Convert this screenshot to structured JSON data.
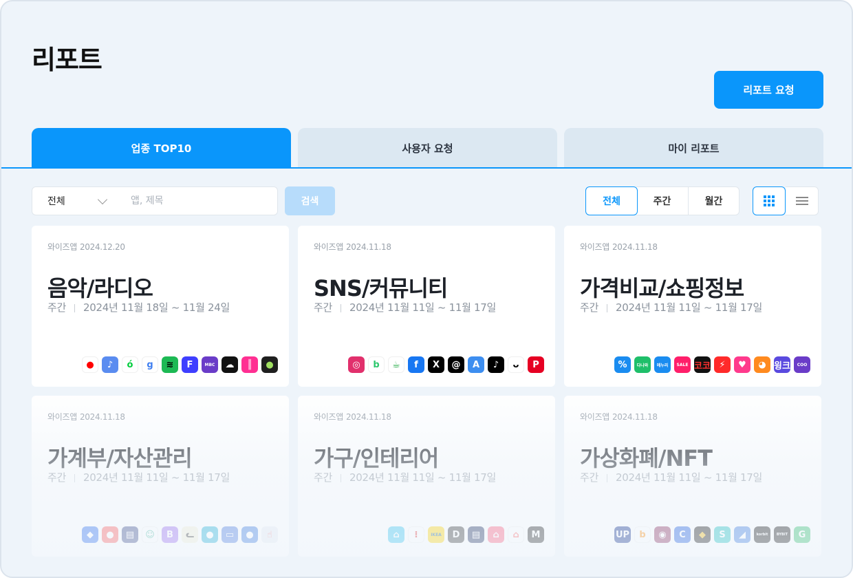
{
  "page_title": "리포트",
  "request_button": "리포트 요청",
  "tabs": [
    {
      "label": "업종 TOP10",
      "active": true
    },
    {
      "label": "사용자 요청",
      "active": false
    },
    {
      "label": "마이 리포트",
      "active": false
    }
  ],
  "filter": {
    "category_selected": "전체",
    "search_placeholder": "앱, 제목",
    "search_button": "검색",
    "periods": [
      "전체",
      "주간",
      "월간"
    ],
    "active_period": "전체",
    "view_modes": [
      "grid-icon",
      "list-icon"
    ],
    "active_view": "grid-icon"
  },
  "colors": {
    "accent": "#0a96fb",
    "tab_inactive": "#dce8f2",
    "background": "#eef4fa"
  },
  "cards": [
    {
      "source": "와이즈앱",
      "date": "2024.12.20",
      "title": "음악/라디오",
      "period_type": "주간",
      "range": "2024년 11월 18일 ~ 11월 24일",
      "icons": [
        {
          "name": "youtube-music-icon",
          "bg": "#ffffff",
          "fg": "#ff0000",
          "glyph": "●"
        },
        {
          "name": "apple-music-icon",
          "bg": "#5a8cf0",
          "fg": "#ffffff",
          "glyph": "♪"
        },
        {
          "name": "melon-icon",
          "bg": "#ffffff",
          "fg": "#00cd3c",
          "glyph": "ó"
        },
        {
          "name": "genie-icon",
          "bg": "#ffffff",
          "fg": "#3e7ef0",
          "glyph": "g"
        },
        {
          "name": "spotify-icon",
          "bg": "#1db954",
          "fg": "#000000",
          "glyph": "≋"
        },
        {
          "name": "flo-icon",
          "bg": "#3f3fff",
          "fg": "#ffffff",
          "glyph": "F"
        },
        {
          "name": "mbc-radio-icon",
          "bg": "#6a3cc8",
          "fg": "#ffffff",
          "glyph": "MBC"
        },
        {
          "name": "soundcloud-icon",
          "bg": "#111111",
          "fg": "#ffffff",
          "glyph": "☁"
        },
        {
          "name": "vibe-icon",
          "bg": "#ff2f92",
          "fg": "#ffffff",
          "glyph": "║"
        },
        {
          "name": "podbbang-icon",
          "bg": "#1f1f1f",
          "fg": "#a0e060",
          "glyph": "●"
        }
      ]
    },
    {
      "source": "와이즈앱",
      "date": "2024.11.18",
      "title": "SNS/커뮤니티",
      "period_type": "주간",
      "range": "2024년 11월 11일 ~ 11월 17일",
      "icons": [
        {
          "name": "instagram-icon",
          "bg": "#e1306c",
          "fg": "#ffffff",
          "glyph": "◎"
        },
        {
          "name": "band-icon",
          "bg": "#ffffff",
          "fg": "#2dc76d",
          "glyph": "b"
        },
        {
          "name": "kakao-story-icon",
          "bg": "#ffffff",
          "fg": "#22aa44",
          "glyph": "☕"
        },
        {
          "name": "facebook-icon",
          "bg": "#1877f2",
          "fg": "#ffffff",
          "glyph": "f"
        },
        {
          "name": "x-icon",
          "bg": "#000000",
          "fg": "#ffffff",
          "glyph": "X"
        },
        {
          "name": "threads-icon",
          "bg": "#000000",
          "fg": "#ffffff",
          "glyph": "@"
        },
        {
          "name": "alight-icon",
          "bg": "#3d8ef0",
          "fg": "#ffffff",
          "glyph": "A"
        },
        {
          "name": "tiktok-icon",
          "bg": "#000000",
          "fg": "#ffffff",
          "glyph": "♪"
        },
        {
          "name": "bunjang-smile-icon",
          "bg": "#ffffff",
          "fg": "#000000",
          "glyph": "ᴗ"
        },
        {
          "name": "pinterest-icon",
          "bg": "#e60023",
          "fg": "#ffffff",
          "glyph": "P"
        }
      ]
    },
    {
      "source": "와이즈앱",
      "date": "2024.11.18",
      "title": "가격비교/쇼핑정보",
      "period_type": "주간",
      "range": "2024년 11월 11일 ~ 11월 17일",
      "icons": [
        {
          "name": "coupon-icon",
          "bg": "#1a8cf0",
          "fg": "#ffffff",
          "glyph": "%"
        },
        {
          "name": "danawa-icon",
          "bg": "#1fbf6a",
          "fg": "#ffffff",
          "glyph": "다나와"
        },
        {
          "name": "enuri-icon",
          "bg": "#1a8cf0",
          "fg": "#ffffff",
          "glyph": "에누리"
        },
        {
          "name": "shopping-deal-icon",
          "bg": "#ff1f6a",
          "fg": "#ffffff",
          "glyph": "SALE"
        },
        {
          "name": "coco-discount-icon",
          "bg": "#111111",
          "fg": "#ff3030",
          "glyph": "코코"
        },
        {
          "name": "lightning-icon",
          "bg": "#ff2a2a",
          "fg": "#ffffff",
          "glyph": "⚡"
        },
        {
          "name": "pinky-icon",
          "bg": "#ff3a8c",
          "fg": "#ffffff",
          "glyph": "♥"
        },
        {
          "name": "shiba-icon",
          "bg": "#ff8a1f",
          "fg": "#ffffff",
          "glyph": "◕"
        },
        {
          "name": "wink-icon",
          "bg": "#5a4adf",
          "fg": "#ffffff",
          "glyph": "윙크"
        },
        {
          "name": "coo-icon",
          "bg": "#6a3cc8",
          "fg": "#ffffff",
          "glyph": "COO"
        }
      ]
    },
    {
      "source": "와이즈앱",
      "date": "2024.11.18",
      "title": "가계부/자산관리",
      "period_type": "주간",
      "range": "2024년 11월 11일 ~ 11월 17일",
      "icons": [
        {
          "name": "banksalad-icon",
          "bg": "#2a6cf0",
          "fg": "#ffffff",
          "glyph": "◆"
        },
        {
          "name": "piggy-bank-icon",
          "bg": "#ff5a5a",
          "fg": "#ffffff",
          "glyph": "●"
        },
        {
          "name": "receipt-icon",
          "bg": "#3b4a8a",
          "fg": "#ffffff",
          "glyph": "▤"
        },
        {
          "name": "smile-icon",
          "bg": "#ffffff",
          "fg": "#30b090",
          "glyph": "☺"
        },
        {
          "name": "b-ledger-icon",
          "bg": "#9b6af0",
          "fg": "#ffffff",
          "glyph": "B"
        },
        {
          "name": "cat-ledger-icon",
          "bg": "#f5f0d8",
          "fg": "#333333",
          "glyph": "ᓚ"
        },
        {
          "name": "pig-icon",
          "bg": "#1fb0d8",
          "fg": "#ffffff",
          "glyph": "●"
        },
        {
          "name": "card-icon",
          "bg": "#4a7ae0",
          "fg": "#ffffff",
          "glyph": "▭"
        },
        {
          "name": "chat-bubble-icon",
          "bg": "#3a7ae0",
          "fg": "#ffffff",
          "glyph": "●"
        },
        {
          "name": "hand-icon",
          "bg": "#e8ecf4",
          "fg": "#ff5a5a",
          "glyph": "☝"
        }
      ]
    },
    {
      "source": "와이즈앱",
      "date": "2024.11.18",
      "title": "가구/인테리어",
      "period_type": "주간",
      "range": "2024년 11월 11일 ~ 11월 17일",
      "icons": [
        {
          "name": "ohouse-icon",
          "bg": "#35c5f0",
          "fg": "#ffffff",
          "glyph": "⌂"
        },
        {
          "name": "hanssem-icon",
          "bg": "#ffffff",
          "fg": "#e02020",
          "glyph": "⁝"
        },
        {
          "name": "ikea-icon",
          "bg": "#ffd400",
          "fg": "#0058a3",
          "glyph": "IKEA"
        },
        {
          "name": "d-icon",
          "bg": "#333333",
          "fg": "#ffffff",
          "glyph": "D"
        },
        {
          "name": "magazine-icon",
          "bg": "#1a2a5a",
          "fg": "#ffffff",
          "glyph": "▤"
        },
        {
          "name": "home-icon",
          "bg": "#ff5a7a",
          "fg": "#ffffff",
          "glyph": "⌂"
        },
        {
          "name": "house-outline-icon",
          "bg": "#ffffff",
          "fg": "#ff5a5a",
          "glyph": "⌂"
        },
        {
          "name": "m-icon",
          "bg": "#222222",
          "fg": "#ffffff",
          "glyph": "M"
        }
      ]
    },
    {
      "source": "와이즈앱",
      "date": "2024.11.18",
      "title": "가상화폐/NFT",
      "period_type": "주간",
      "range": "2024년 11월 11일 ~ 11월 17일",
      "icons": [
        {
          "name": "upbit-icon",
          "bg": "#0a2a8a",
          "fg": "#ffffff",
          "glyph": "UP"
        },
        {
          "name": "bithumb-icon",
          "bg": "#ffffff",
          "fg": "#ff8a00",
          "glyph": "b"
        },
        {
          "name": "coin-icon",
          "bg": "#8a2a5a",
          "fg": "#ffffff",
          "glyph": "◉"
        },
        {
          "name": "coinone-icon",
          "bg": "#1a5adf",
          "fg": "#ffffff",
          "glyph": "C"
        },
        {
          "name": "binance-icon",
          "bg": "#111111",
          "fg": "#f0b90b",
          "glyph": "◆"
        },
        {
          "name": "s-icon",
          "bg": "#1ac0c0",
          "fg": "#ffffff",
          "glyph": "S"
        },
        {
          "name": "bird-icon",
          "bg": "#3a7ae0",
          "fg": "#ffffff",
          "glyph": "◢"
        },
        {
          "name": "korbit-icon",
          "bg": "#111111",
          "fg": "#ffffff",
          "glyph": "korbit"
        },
        {
          "name": "bybit-icon",
          "bg": "#111111",
          "fg": "#ffffff",
          "glyph": "BYBIT"
        },
        {
          "name": "g-icon",
          "bg": "#2fbf6a",
          "fg": "#ffffff",
          "glyph": "G"
        }
      ]
    }
  ]
}
